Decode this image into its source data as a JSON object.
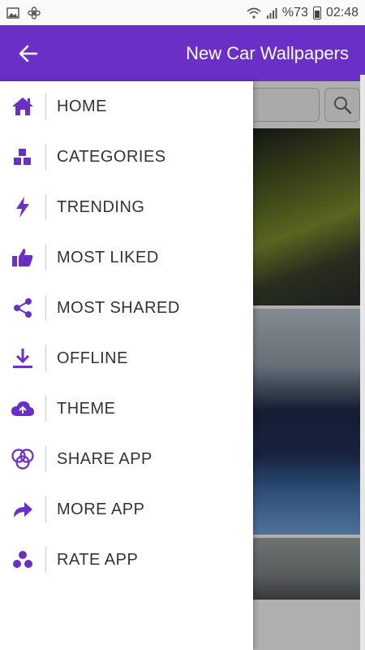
{
  "status_bar": {
    "battery": "%73",
    "time": "02:48"
  },
  "app_bar": {
    "title": "New Car Wallpapers"
  },
  "colors": {
    "accent": "#6a2fc7",
    "icon": "#6a2fc7"
  },
  "drawer": {
    "items": [
      {
        "label": "HOME",
        "icon": "home-icon"
      },
      {
        "label": "CATEGORIES",
        "icon": "categories-icon"
      },
      {
        "label": "TRENDING",
        "icon": "lightning-icon"
      },
      {
        "label": "MOST LIKED",
        "icon": "thumbs-up-icon"
      },
      {
        "label": "MOST SHARED",
        "icon": "share-icon"
      },
      {
        "label": "OFFLINE",
        "icon": "download-icon"
      },
      {
        "label": "THEME",
        "icon": "cloud-upload-icon"
      },
      {
        "label": "SHARE APP",
        "icon": "circles-icon"
      },
      {
        "label": "MORE APP",
        "icon": "forward-arrow-icon"
      },
      {
        "label": "RATE APP",
        "icon": "dots-icon"
      }
    ]
  }
}
